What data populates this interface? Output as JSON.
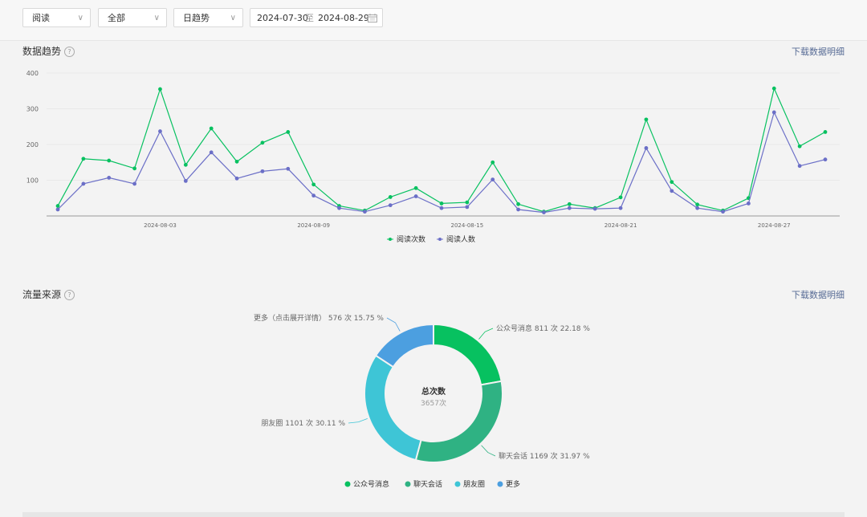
{
  "filters": {
    "metric": "阅读",
    "scope": "全部",
    "granularity": "日趋势",
    "date_start": "2024-07-30",
    "date_sep": "至",
    "date_end": "2024-08-29"
  },
  "trend_section": {
    "title": "数据趋势",
    "download": "下载数据明细"
  },
  "source_section": {
    "title": "流量来源",
    "download": "下载数据明细"
  },
  "colors": {
    "read_count": "#07c160",
    "readers": "#6b6fc7"
  },
  "chart_data": [
    {
      "type": "line",
      "x": [
        "2024-07-30",
        "2024-07-31",
        "2024-08-01",
        "2024-08-02",
        "2024-08-03",
        "2024-08-04",
        "2024-08-05",
        "2024-08-06",
        "2024-08-07",
        "2024-08-08",
        "2024-08-09",
        "2024-08-10",
        "2024-08-11",
        "2024-08-12",
        "2024-08-13",
        "2024-08-14",
        "2024-08-15",
        "2024-08-16",
        "2024-08-17",
        "2024-08-18",
        "2024-08-19",
        "2024-08-20",
        "2024-08-21",
        "2024-08-22",
        "2024-08-23",
        "2024-08-24",
        "2024-08-25",
        "2024-08-26",
        "2024-08-27",
        "2024-08-28",
        "2024-08-29"
      ],
      "x_tick_labels": [
        "2024-08-03",
        "2024-08-09",
        "2024-08-15",
        "2024-08-21",
        "2024-08-27"
      ],
      "y_ticks": [
        100,
        200,
        300,
        400
      ],
      "ylim": [
        0,
        400
      ],
      "grid": true,
      "legend": "bottom",
      "series": [
        {
          "name": "阅读次数",
          "values": [
            28,
            160,
            155,
            133,
            355,
            143,
            245,
            152,
            205,
            235,
            88,
            28,
            15,
            53,
            78,
            35,
            38,
            150,
            33,
            12,
            33,
            22,
            52,
            270,
            95,
            32,
            15,
            50,
            357,
            195,
            235
          ]
        },
        {
          "name": "阅读人数",
          "values": [
            18,
            90,
            107,
            90,
            237,
            98,
            178,
            105,
            125,
            132,
            57,
            22,
            12,
            30,
            55,
            22,
            25,
            102,
            18,
            10,
            22,
            20,
            22,
            190,
            70,
            22,
            12,
            35,
            290,
            140,
            158
          ]
        }
      ]
    },
    {
      "type": "pie",
      "center_title": "总次数",
      "center_value": "3657次",
      "legend": "bottom",
      "slices": [
        {
          "name": "公众号消息",
          "value": 811,
          "unit": "次",
          "percent": "22.18 %",
          "color": "#07c160"
        },
        {
          "name": "聊天会话",
          "value": 1169,
          "unit": "次",
          "percent": "31.97 %",
          "color": "#2fb283"
        },
        {
          "name": "朋友圈",
          "value": 1101,
          "unit": "次",
          "percent": "30.11 %",
          "color": "#3ec5d6"
        },
        {
          "name": "更多",
          "label_name": "更多（点击展开详情）",
          "value": 576,
          "unit": "次",
          "percent": "15.75 %",
          "color": "#4c9fe0"
        }
      ]
    }
  ]
}
